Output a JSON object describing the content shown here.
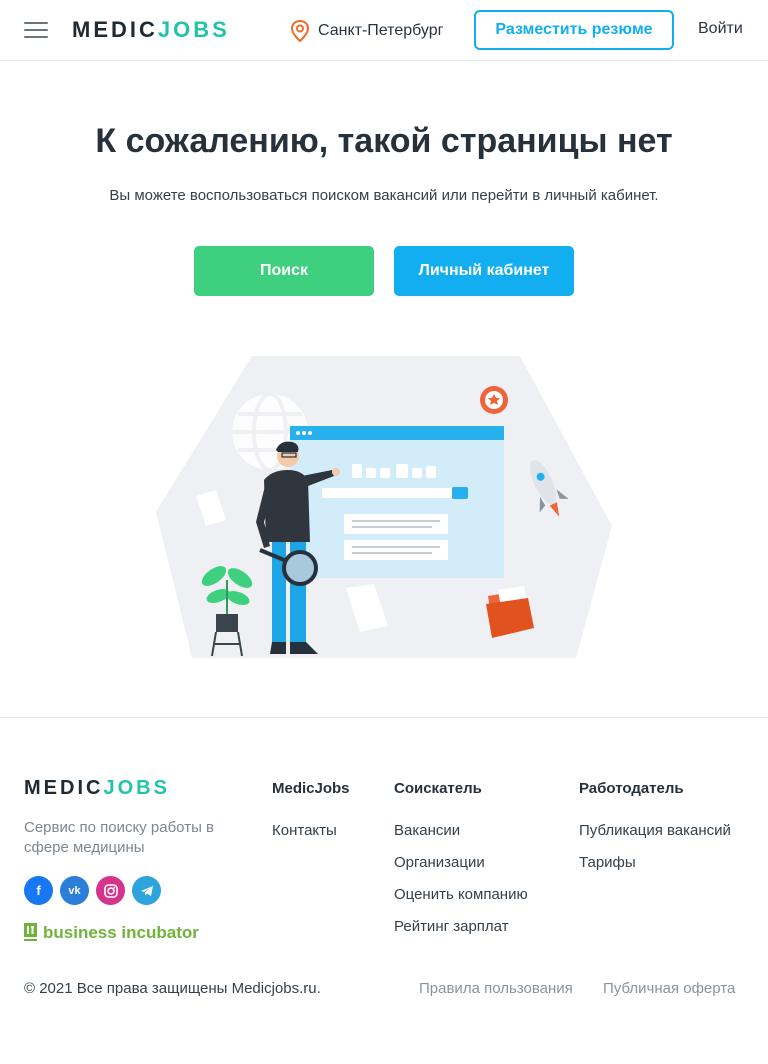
{
  "header": {
    "logo_part1": "MEDIC",
    "logo_part2": "JOBS",
    "city": "Санкт-Петербург",
    "post_resume": "Разместить резюме",
    "login": "Войти"
  },
  "main": {
    "title": "К сожалению, такой страницы нет",
    "subtitle": "Вы можете воспользоваться поиском вакансий или перейти в личный кабинет.",
    "search_button": "Поиск",
    "cabinet_button": "Личный кабинет"
  },
  "footer": {
    "logo_part1": "MEDIC",
    "logo_part2": "JOBS",
    "tagline": "Сервис по поиску работы в сфере медицины",
    "socials": [
      "facebook",
      "vkontakte",
      "instagram",
      "telegram"
    ],
    "incubator": "business incubator",
    "columns": [
      {
        "title": "MedicJobs",
        "links": [
          "Контакты"
        ]
      },
      {
        "title": "Соискатель",
        "links": [
          "Вакансии",
          "Организации",
          "Оценить компанию",
          "Рейтинг зарплат"
        ]
      },
      {
        "title": "Работодатель",
        "links": [
          "Публикация вакансий",
          "Тарифы"
        ]
      }
    ],
    "copyright": "© 2021 Все права защищены Medicjobs.ru.",
    "rules": "Правила пользования",
    "offer": "Публичная оферта"
  },
  "colors": {
    "brand_dark": "#1f2a33",
    "brand_teal": "#22c4a9",
    "accent_blue": "#12aef0",
    "accent_green": "#3ed07f"
  }
}
